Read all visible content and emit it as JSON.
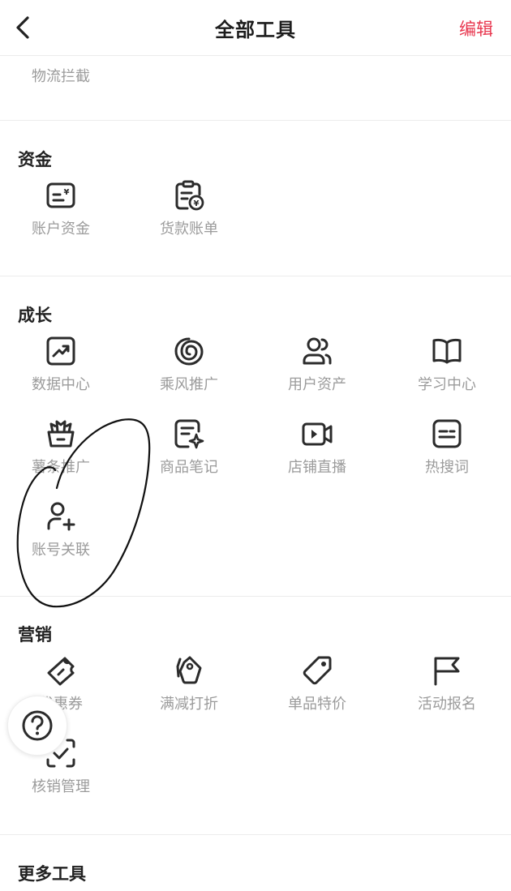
{
  "header": {
    "title": "全部工具",
    "edit_label": "编辑"
  },
  "partial_item": {
    "label": "物流拦截"
  },
  "sections": {
    "funds": {
      "title": "资金",
      "items": [
        {
          "label": "账户资金",
          "icon": "account-funds-icon"
        },
        {
          "label": "货款账单",
          "icon": "payment-bill-icon"
        }
      ]
    },
    "growth": {
      "title": "成长",
      "items": [
        {
          "label": "数据中心",
          "icon": "chart-trend-icon"
        },
        {
          "label": "乘风推广",
          "icon": "wind-spiral-icon"
        },
        {
          "label": "用户资产",
          "icon": "users-icon"
        },
        {
          "label": "学习中心",
          "icon": "book-icon"
        },
        {
          "label": "薯条推广",
          "icon": "fries-icon"
        },
        {
          "label": "商品笔记",
          "icon": "note-sparkle-icon"
        },
        {
          "label": "店铺直播",
          "icon": "video-camera-icon"
        },
        {
          "label": "热搜词",
          "icon": "hot-search-icon"
        },
        {
          "label": "账号关联",
          "icon": "add-user-icon"
        }
      ]
    },
    "marketing": {
      "title": "营销",
      "items": [
        {
          "label": "优惠券",
          "icon": "coupon-icon"
        },
        {
          "label": "满减打折",
          "icon": "discount-tag-icon"
        },
        {
          "label": "单品特价",
          "icon": "price-tag-icon"
        },
        {
          "label": "活动报名",
          "icon": "flag-icon"
        },
        {
          "label": "核销管理",
          "icon": "scan-check-icon"
        }
      ]
    },
    "more": {
      "title": "更多工具"
    }
  },
  "help": {
    "icon": "question-icon"
  },
  "colors": {
    "accent": "#e8364e",
    "label": "#9b9b9b",
    "icon": "#2b2b2b"
  }
}
